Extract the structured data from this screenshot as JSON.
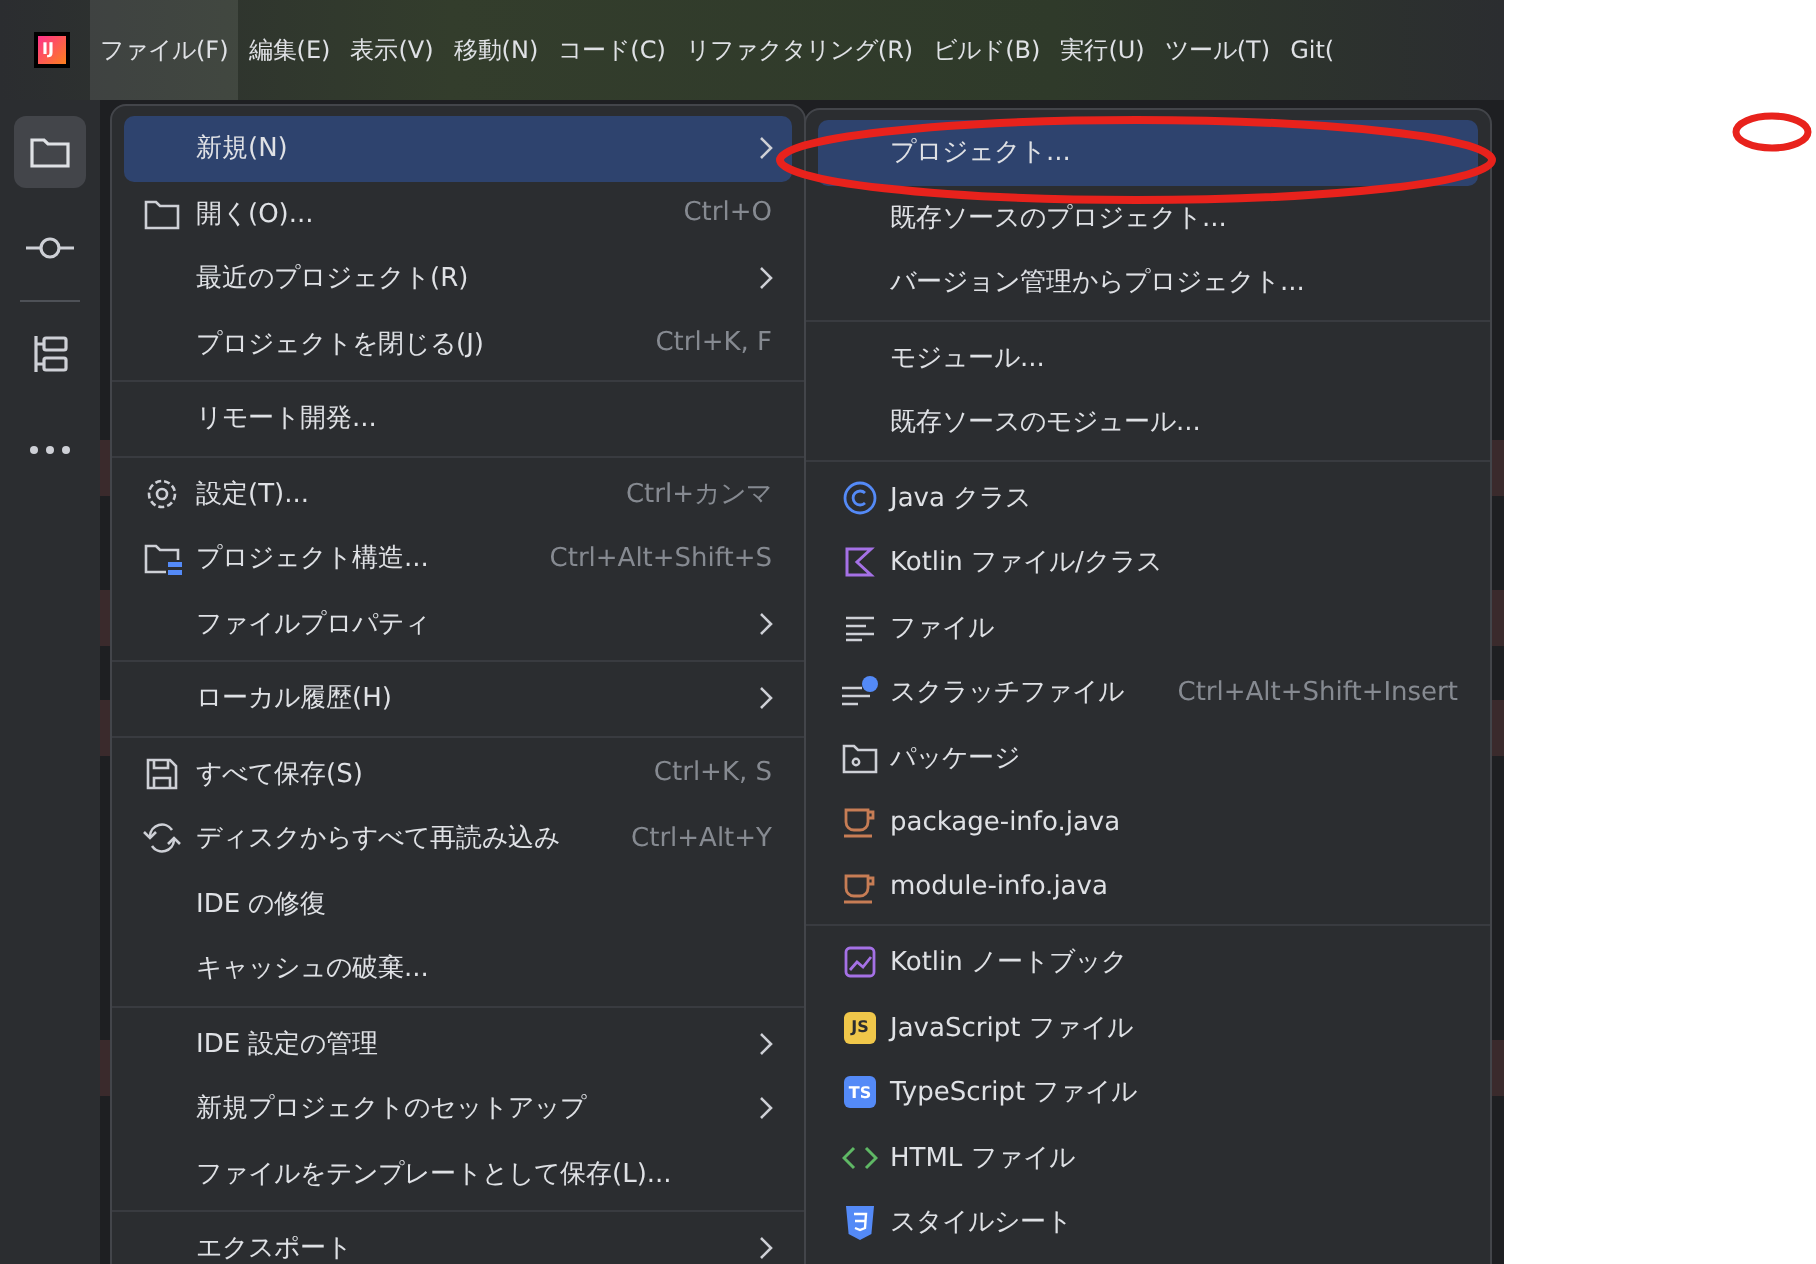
{
  "app_logo": "IJ",
  "menubar": [
    {
      "label": "ファイル(F)",
      "selected": true
    },
    {
      "label": "編集(E)",
      "selected": false
    },
    {
      "label": "表示(V)",
      "selected": false
    },
    {
      "label": "移動(N)",
      "selected": false
    },
    {
      "label": "コード(C)",
      "selected": false
    },
    {
      "label": "リファクタリング(R)",
      "selected": false
    },
    {
      "label": "ビルド(B)",
      "selected": false
    },
    {
      "label": "実行(U)",
      "selected": false
    },
    {
      "label": "ツール(T)",
      "selected": false
    },
    {
      "label": "Git(",
      "selected": false
    }
  ],
  "tool_strip": [
    {
      "selected": true
    },
    {
      "selected": false
    },
    {
      "selected": false
    },
    {
      "selected": false
    }
  ],
  "file_menu": [
    {
      "items": [
        {
          "label": "新規(N)",
          "selected": true,
          "submenu": true
        },
        {
          "label": "開く(O)...",
          "shortcut": "Ctrl+O",
          "selected": false,
          "submenu": false
        },
        {
          "label": "最近のプロジェクト(R)",
          "selected": false,
          "submenu": true
        },
        {
          "label": "プロジェクトを閉じる(J)",
          "shortcut": "Ctrl+K, F",
          "selected": false,
          "submenu": false
        }
      ]
    },
    {
      "items": [
        {
          "label": "リモート開発...",
          "selected": false,
          "submenu": false
        }
      ]
    },
    {
      "items": [
        {
          "label": "設定(T)...",
          "shortcut": "Ctrl+カンマ",
          "selected": false,
          "submenu": false
        },
        {
          "label": "プロジェクト構造...",
          "shortcut": "Ctrl+Alt+Shift+S",
          "selected": false,
          "submenu": false
        },
        {
          "label": "ファイルプロパティ",
          "selected": false,
          "submenu": true
        }
      ]
    },
    {
      "items": [
        {
          "label": "ローカル履歴(H)",
          "selected": false,
          "submenu": true
        }
      ]
    },
    {
      "items": [
        {
          "label": "すべて保存(S)",
          "shortcut": "Ctrl+K, S",
          "selected": false,
          "submenu": false
        },
        {
          "label": "ディスクからすべて再読み込み",
          "shortcut": "Ctrl+Alt+Y",
          "selected": false,
          "submenu": false
        },
        {
          "label": "IDE の修復",
          "selected": false,
          "submenu": false
        },
        {
          "label": "キャッシュの破棄...",
          "selected": false,
          "submenu": false
        }
      ]
    },
    {
      "items": [
        {
          "label": "IDE 設定の管理",
          "selected": false,
          "submenu": true
        },
        {
          "label": "新規プロジェクトのセットアップ",
          "selected": false,
          "submenu": true
        },
        {
          "label": "ファイルをテンプレートとして保存(L)...",
          "selected": false,
          "submenu": false
        }
      ]
    },
    {
      "items": [
        {
          "label": "エクスポート",
          "selected": false,
          "submenu": true
        }
      ]
    }
  ],
  "new_submenu": [
    {
      "items": [
        {
          "label": "プロジェクト...",
          "selected": true
        },
        {
          "label": "既存ソースのプロジェクト...",
          "selected": false
        },
        {
          "label": "バージョン管理からプロジェクト...",
          "selected": false
        }
      ]
    },
    {
      "items": [
        {
          "label": "モジュール...",
          "selected": false
        },
        {
          "label": "既存ソースのモジュール...",
          "selected": false
        }
      ]
    },
    {
      "items": [
        {
          "label": "Java クラス",
          "selected": false
        },
        {
          "label": "Kotlin ファイル/クラス",
          "selected": false
        },
        {
          "label": "ファイル",
          "selected": false
        },
        {
          "label": "スクラッチファイル",
          "shortcut": "Ctrl+Alt+Shift+Insert",
          "selected": false
        },
        {
          "label": "パッケージ",
          "selected": false
        },
        {
          "label": "package-info.java",
          "selected": false
        },
        {
          "label": "module-info.java",
          "selected": false
        }
      ]
    },
    {
      "items": [
        {
          "label": "Kotlin ノートブック",
          "selected": false
        },
        {
          "label": "JavaScript ファイル",
          "badge": "JS",
          "selected": false
        },
        {
          "label": "TypeScript ファイル",
          "badge": "TS",
          "selected": false
        },
        {
          "label": "HTML ファイル",
          "selected": false
        },
        {
          "label": "スタイルシート",
          "selected": false
        }
      ]
    }
  ]
}
